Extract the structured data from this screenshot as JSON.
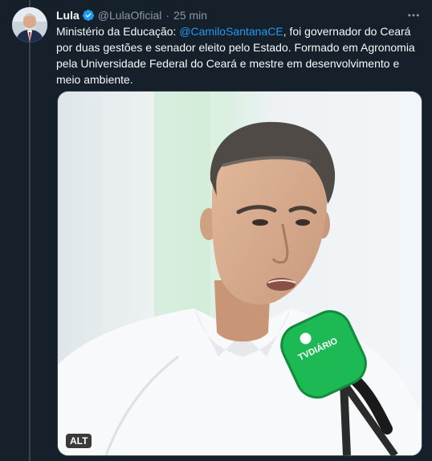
{
  "tweet": {
    "author_name": "Lula",
    "handle": "@LulaOficial",
    "separator": "·",
    "time": "25 min",
    "text_part1": "Ministério da Educação: ",
    "mention": "@CamiloSantanaCE",
    "text_part2": ", foi governador do Ceará por duas gestões e senador eleito pelo Estado. Formado em Agronomia pela Universidade Federal do Ceará e mestre em desenvolvimento e meio ambiente.",
    "media_alt_badge": "ALT",
    "microphone_brand": "TVDIÁRIO"
  },
  "icons": {
    "verified": "verified-badge-icon",
    "more": "more-options-icon"
  },
  "colors": {
    "background": "#15202b",
    "link": "#1d9bf0",
    "muted": "#8b98a5",
    "mic_green": "#1db954"
  }
}
